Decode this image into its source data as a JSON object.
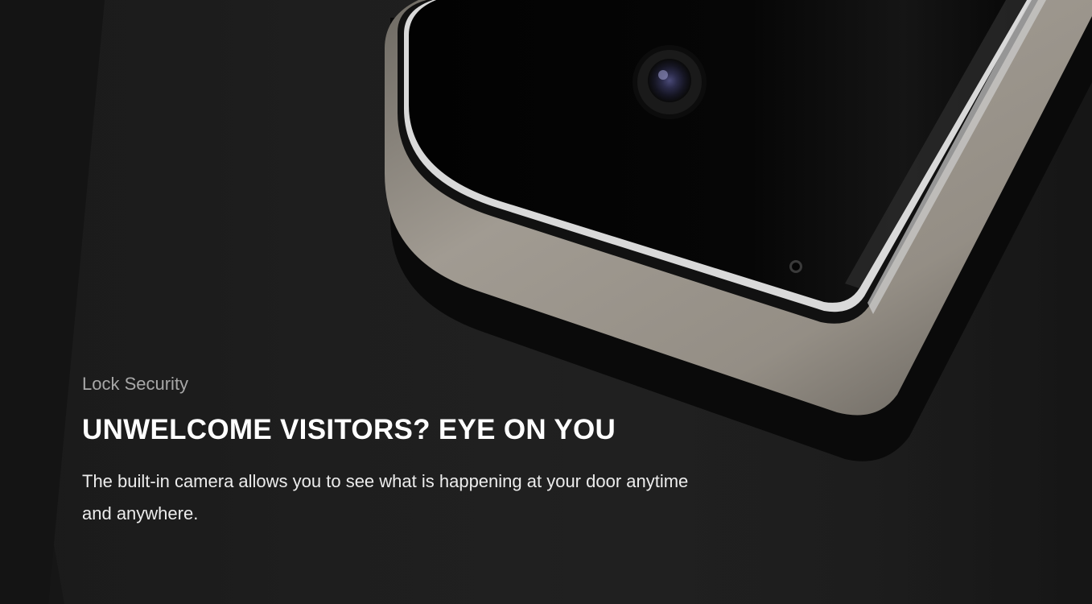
{
  "feature": {
    "eyebrow": "Lock Security",
    "headline": "UNWELCOME VISITORS? EYE ON YOU",
    "description": "The built-in camera allows you to see what is happening at your door anytime and anywhere."
  },
  "colors": {
    "background": "#1a1a1a",
    "device_frame": "#8c8780",
    "glass": "#050505",
    "headline": "#ffffff",
    "eyebrow": "#a8a8a8"
  }
}
